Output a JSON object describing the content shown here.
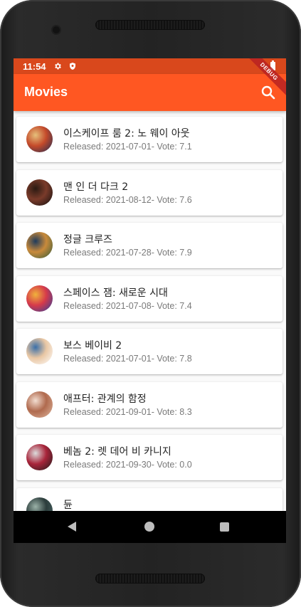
{
  "status_bar": {
    "time": "11:54",
    "icons": [
      "gear-icon",
      "shield-icon",
      "battery-icon"
    ],
    "debug_banner": "DEBUG"
  },
  "app_bar": {
    "title": "Movies",
    "search_icon": "search-icon",
    "color": "#ff5722"
  },
  "movies": [
    {
      "title": "이스케이프 룸 2: 노 웨이 아웃",
      "subtitle": "Released: 2021-07-01- Vote: 7.1",
      "poster_colors": [
        "#1b2a55",
        "#c44a2a",
        "#e6c07b"
      ]
    },
    {
      "title": "맨 인 더 다크 2",
      "subtitle": "Released: 2021-08-12- Vote: 7.6",
      "poster_colors": [
        "#0d0d0d",
        "#7a3b2a",
        "#2b1a12"
      ]
    },
    {
      "title": "정글 크루즈",
      "subtitle": "Released: 2021-07-28- Vote: 7.9",
      "poster_colors": [
        "#2e5a3a",
        "#c98a3b",
        "#1f3b5c"
      ]
    },
    {
      "title": "스페이스 잼: 새로운 시대",
      "subtitle": "Released: 2021-07-08- Vote: 7.4",
      "poster_colors": [
        "#2a3f9e",
        "#d63a4a",
        "#f0b23b"
      ]
    },
    {
      "title": "보스 베이비 2",
      "subtitle": "Released: 2021-07-01- Vote: 7.8",
      "poster_colors": [
        "#ffffff",
        "#e9c7a4",
        "#3a6fa8"
      ]
    },
    {
      "title": "애프터: 관계의 함정",
      "subtitle": "Released: 2021-09-01- Vote: 8.3",
      "poster_colors": [
        "#e0b8a0",
        "#b06a4e",
        "#f2ddd0"
      ]
    },
    {
      "title": "베놈 2: 렛 데어 비 카니지",
      "subtitle": "Released: 2021-09-30- Vote: 0.0",
      "poster_colors": [
        "#1a1a1a",
        "#a8243a",
        "#dcdcdc"
      ]
    },
    {
      "title": "듄",
      "subtitle": "",
      "poster_colors": [
        "#4d6b6a",
        "#2c3d3c",
        "#9bb2a8"
      ]
    }
  ],
  "nav": {
    "back_icon": "back-icon",
    "home_icon": "home-icon",
    "recents_icon": "recents-icon"
  }
}
